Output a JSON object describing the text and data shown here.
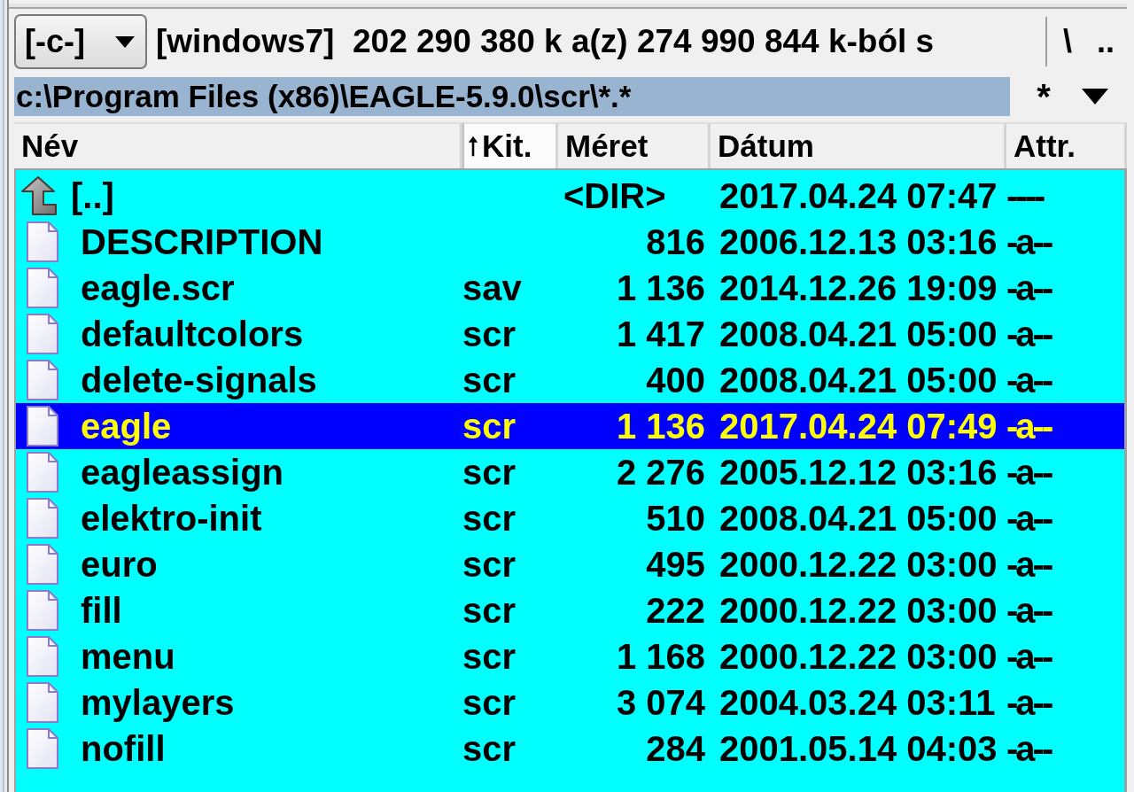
{
  "drive_bar": {
    "drive": "[-c-]",
    "info": "[windows7]  202 290 380 k a(z) 274 990 844 k-ból s",
    "buttons": [
      "\\",
      ".."
    ]
  },
  "path_bar": {
    "path": "c:\\Program Files (x86)\\EAGLE-5.9.0\\scr\\*.*",
    "button": "*"
  },
  "columns": [
    {
      "label": "Név",
      "sorted": false
    },
    {
      "label": "Kit.",
      "sorted": true
    },
    {
      "label": "Méret",
      "sorted": false
    },
    {
      "label": "Dátum",
      "sorted": false
    },
    {
      "label": "Attr.",
      "sorted": false
    }
  ],
  "rows": [
    {
      "kind": "parent",
      "name": "[..]",
      "size": "<DIR>",
      "date": "2017.04.24 07:47",
      "attr": "----",
      "selected": false
    },
    {
      "kind": "file",
      "name": "DESCRIPTION",
      "size": "816",
      "date": "2006.12.13 03:16",
      "attr": "-a--",
      "selected": false
    },
    {
      "kind": "file",
      "name": "eagle.scr",
      "ext": "sav",
      "size": "1 136",
      "date": "2014.12.26 19:09",
      "attr": "-a--",
      "selected": false
    },
    {
      "kind": "file",
      "name": "defaultcolors",
      "ext": "scr",
      "size": "1 417",
      "date": "2008.04.21 05:00",
      "attr": "-a--",
      "selected": false
    },
    {
      "kind": "file",
      "name": "delete-signals",
      "ext": "scr",
      "size": "400",
      "date": "2008.04.21 05:00",
      "attr": "-a--",
      "selected": false
    },
    {
      "kind": "file",
      "name": "eagle",
      "ext": "scr",
      "size": "1 136",
      "date": "2017.04.24 07:49",
      "attr": "-a--",
      "selected": true
    },
    {
      "kind": "file",
      "name": "eagleassign",
      "ext": "scr",
      "size": "2 276",
      "date": "2005.12.12 03:16",
      "attr": "-a--",
      "selected": false
    },
    {
      "kind": "file",
      "name": "elektro-init",
      "ext": "scr",
      "size": "510",
      "date": "2008.04.21 05:00",
      "attr": "-a--",
      "selected": false
    },
    {
      "kind": "file",
      "name": "euro",
      "ext": "scr",
      "size": "495",
      "date": "2000.12.22 03:00",
      "attr": "-a--",
      "selected": false
    },
    {
      "kind": "file",
      "name": "fill",
      "ext": "scr",
      "size": "222",
      "date": "2000.12.22 03:00",
      "attr": "-a--",
      "selected": false
    },
    {
      "kind": "file",
      "name": "menu",
      "ext": "scr",
      "size": "1 168",
      "date": "2000.12.22 03:00",
      "attr": "-a--",
      "selected": false
    },
    {
      "kind": "file",
      "name": "mylayers",
      "ext": "scr",
      "size": "3 074",
      "date": "2004.03.24 03:11",
      "attr": "-a--",
      "selected": false
    },
    {
      "kind": "file",
      "name": "nofill",
      "ext": "scr",
      "size": "284",
      "date": "2001.05.14 04:03",
      "attr": "-a--",
      "selected": false
    }
  ]
}
